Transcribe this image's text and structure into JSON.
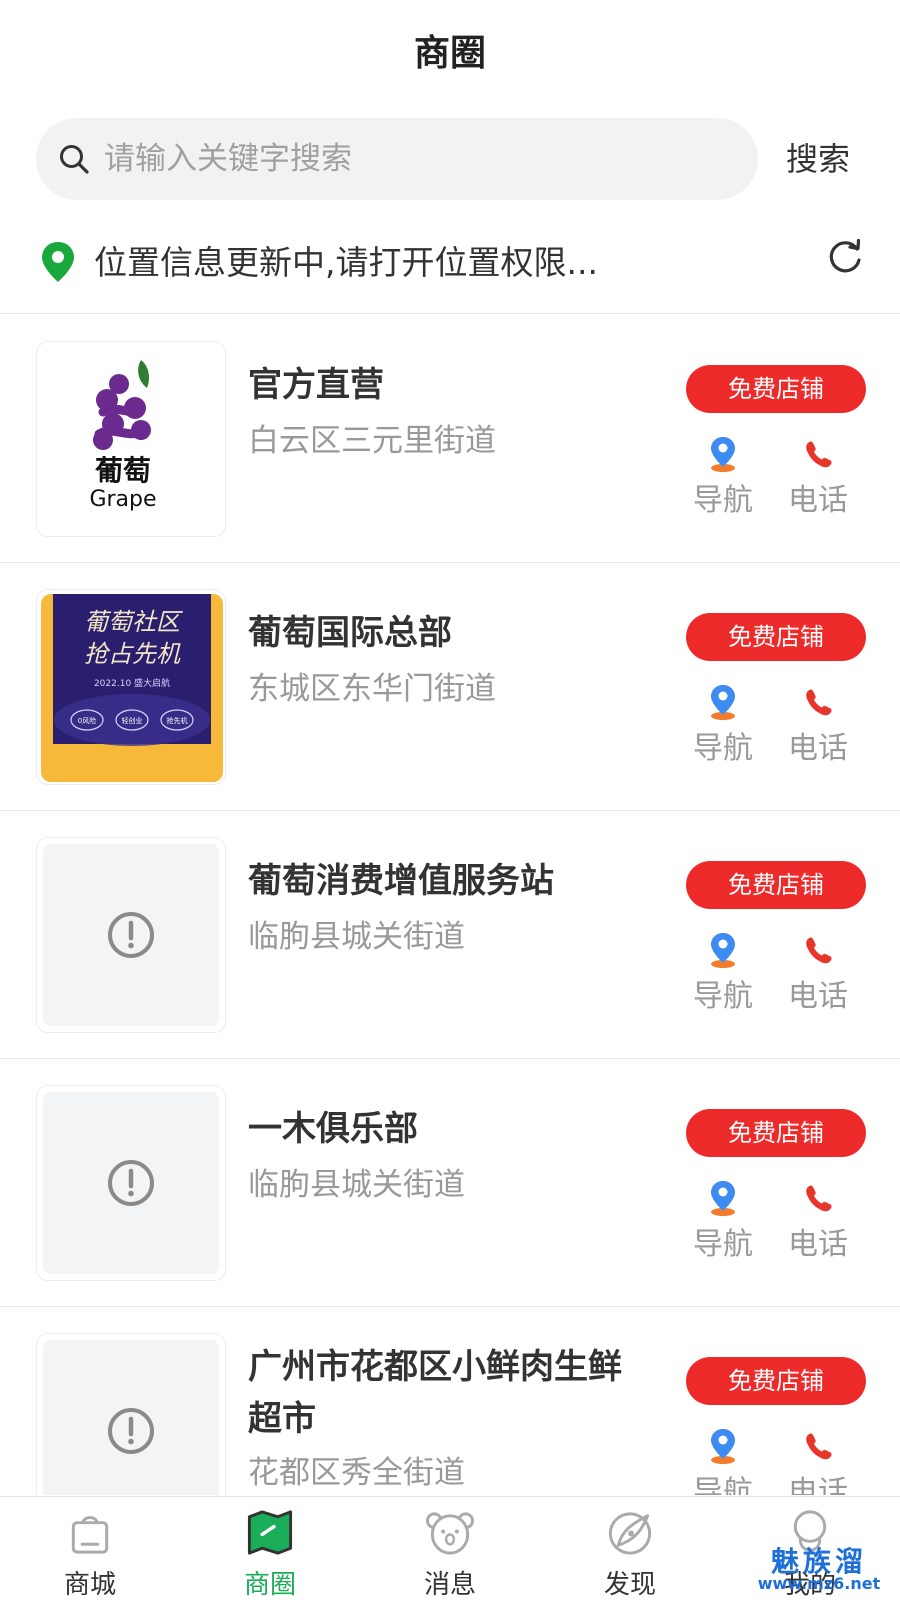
{
  "header": {
    "title": "商圈"
  },
  "search": {
    "placeholder": "请输入关键字搜索",
    "value": "",
    "button_label": "搜索"
  },
  "location": {
    "text": "位置信息更新中,请打开位置权限..."
  },
  "stores": [
    {
      "name": "官方直营",
      "address": "白云区三元里街道",
      "badge": "免费店铺",
      "nav_label": "导航",
      "call_label": "电话",
      "thumb": "grape-logo",
      "thumb_text_cn": "葡萄",
      "thumb_text_en": "Grape"
    },
    {
      "name": "葡萄国际总部",
      "address": "东城区东华门街道",
      "badge": "免费店铺",
      "nav_label": "导航",
      "call_label": "电话",
      "thumb": "community-poster",
      "thumb_line1": "葡萄社区",
      "thumb_line2": "抢占先机",
      "thumb_line3": "2022.10  盛大启航",
      "thumb_pills": [
        "0风险",
        "轻创业",
        "抢先机"
      ]
    },
    {
      "name": "葡萄消费增值服务站",
      "address": "临朐县城关街道",
      "badge": "免费店铺",
      "nav_label": "导航",
      "call_label": "电话",
      "thumb": "placeholder-alert-icon"
    },
    {
      "name": "一木俱乐部",
      "address": "临朐县城关街道",
      "badge": "免费店铺",
      "nav_label": "导航",
      "call_label": "电话",
      "thumb": "placeholder-alert-icon"
    },
    {
      "name": "广州市花都区小鲜肉生鲜超市",
      "address": "花都区秀全街道",
      "badge": "免费店铺",
      "nav_label": "导航",
      "call_label": "电话",
      "thumb": "placeholder-alert-icon"
    }
  ],
  "tabbar": {
    "items": [
      {
        "label": "商城",
        "icon": "shopping-bag-icon",
        "active": false
      },
      {
        "label": "商圈",
        "icon": "map-icon",
        "active": true
      },
      {
        "label": "消息",
        "icon": "koala-icon",
        "active": false
      },
      {
        "label": "发现",
        "icon": "compass-leaf-icon",
        "active": false
      },
      {
        "label": "我的",
        "icon": "person-icon",
        "active": false
      }
    ]
  },
  "watermark": {
    "main": "魅族溜",
    "url": "www.mz6.net"
  },
  "colors": {
    "accent_green": "#1aad5a",
    "badge_red": "#ee2b2b",
    "nav_blue": "#3d8bf0",
    "nav_orange": "#f57a2c",
    "call_red": "#e8352c",
    "text_gray": "#999999"
  }
}
